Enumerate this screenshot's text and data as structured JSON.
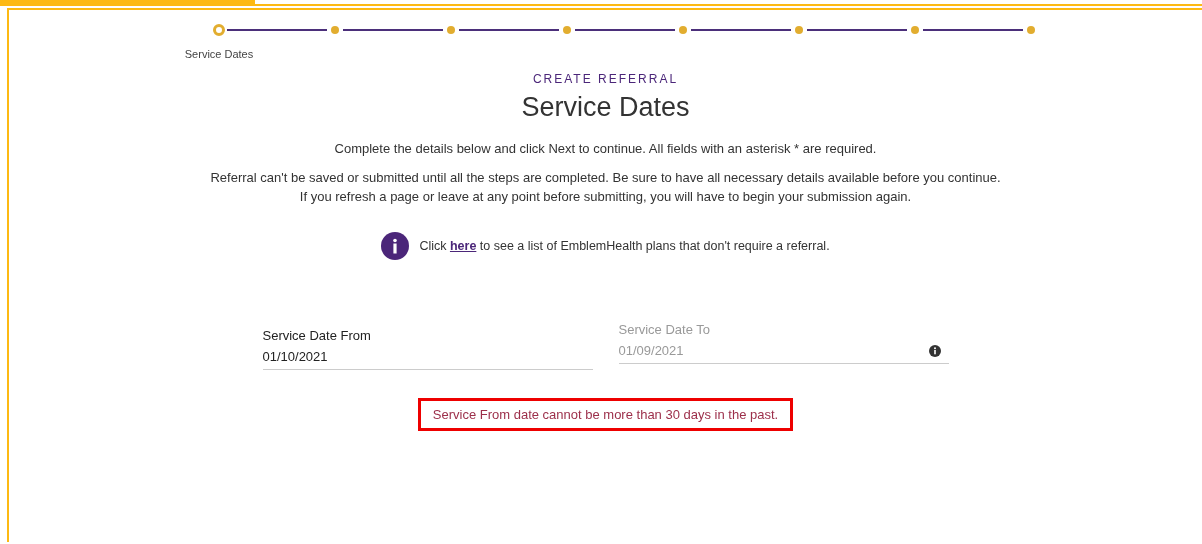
{
  "steps": [
    {
      "label": "Service Dates",
      "current": true
    },
    {
      "current": false
    },
    {
      "current": false
    },
    {
      "current": false
    },
    {
      "current": false
    },
    {
      "current": false
    },
    {
      "current": false
    },
    {
      "current": false
    }
  ],
  "eyebrow": "CREATE REFERRAL",
  "title": "Service Dates",
  "instructions": [
    "Complete the details below and click Next to continue. All fields with an asterisk * are required.",
    "Referral can't be saved or submitted until all the steps are completed. Be sure to have all necessary details available before you continue. If you refresh a page or leave at any point before submitting, you will have to begin your submission again."
  ],
  "info": {
    "before": "Click",
    "link": "here",
    "after": "to see a list of EmblemHealth plans that don't require a referral."
  },
  "fields": [
    {
      "label": "Service Date From",
      "value": "01/10/2021",
      "disabled": false
    },
    {
      "label": "Service Date To",
      "value": "01/09/2021",
      "disabled": true
    }
  ],
  "error": "Service From date cannot be more than 30 days in the past."
}
